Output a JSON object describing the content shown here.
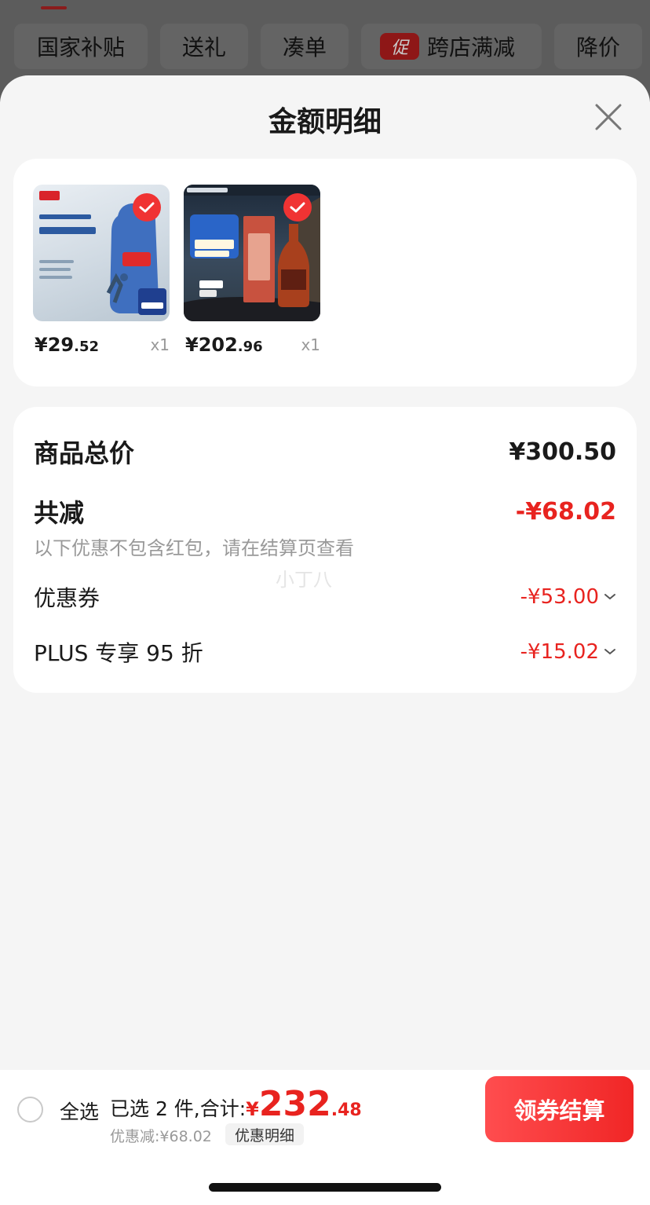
{
  "filters": [
    {
      "label": "国家补贴"
    },
    {
      "label": "送礼"
    },
    {
      "label": "凑单"
    },
    {
      "label": "跨店满减",
      "badge": "促"
    },
    {
      "label": "降价"
    }
  ],
  "sheet": {
    "title": "金额明细"
  },
  "products": [
    {
      "price_int": "¥29",
      "price_dec": ".52",
      "qty": "x1",
      "selected": true
    },
    {
      "price_int": "¥202",
      "price_dec": ".96",
      "qty": "x1",
      "selected": true
    }
  ],
  "summary": {
    "total_label": "商品总价",
    "total_value": "¥300.50",
    "reduce_label": "共减",
    "reduce_value": "-¥68.02",
    "hint": "以下优惠不包含红包，请在结算页查看",
    "watermark": "小丁八",
    "items": [
      {
        "label": "优惠券",
        "value": "-¥53.00"
      },
      {
        "label": "PLUS 专享 95 折",
        "value": "-¥15.02"
      }
    ]
  },
  "bottom": {
    "select_all": "全选",
    "selected_prefix": "已选 2 件,合计:",
    "currency": "¥",
    "total_big": "232",
    "total_small": ".48",
    "savings": "优惠减:¥68.02",
    "detail_link": "优惠明细",
    "checkout": "领券结算"
  },
  "colors": {
    "accent": "#e8231f",
    "checkout": "#f02626"
  }
}
